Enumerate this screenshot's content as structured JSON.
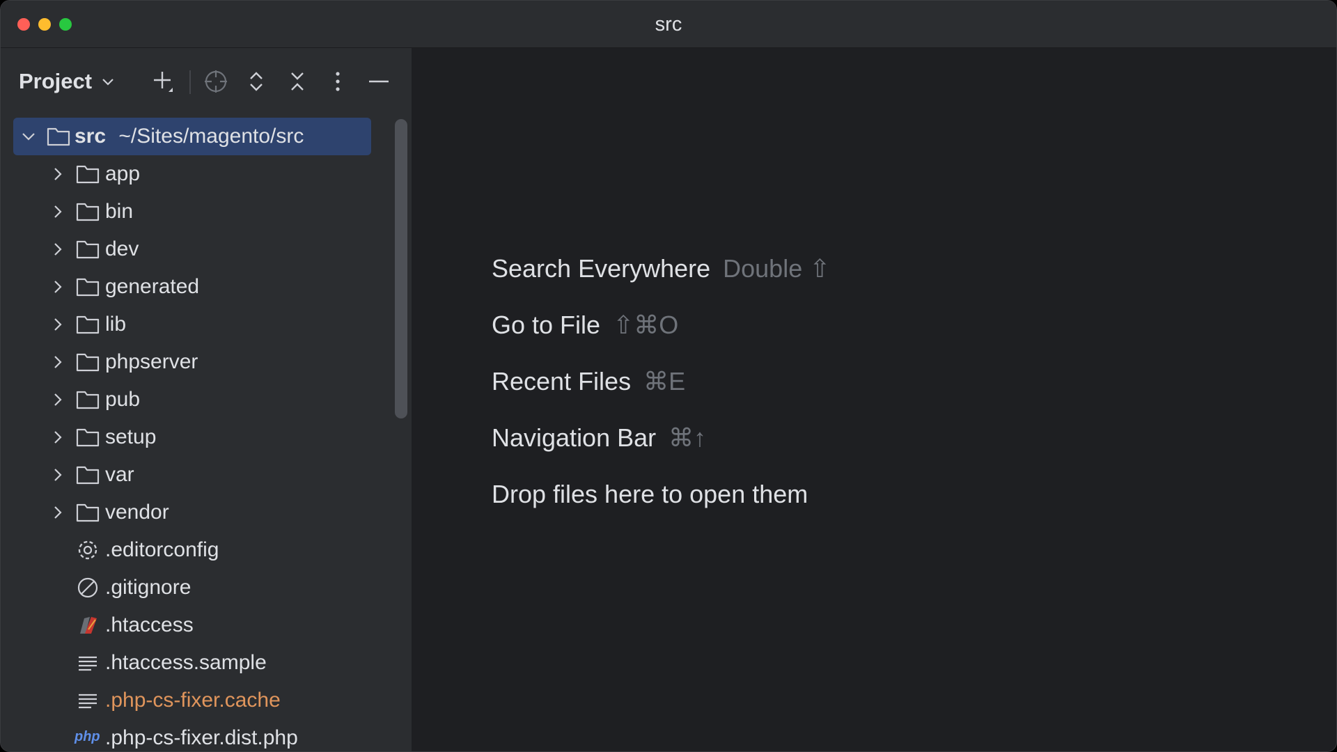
{
  "window": {
    "title": "src"
  },
  "sidebar": {
    "project_label": "Project",
    "toolbar": {
      "new": "plus-icon",
      "locate": "crosshair-icon",
      "expand": "expand-all-icon",
      "collapse": "collapse-all-icon",
      "options": "more-vertical-icon",
      "hide": "minimize-icon"
    },
    "root": {
      "name": "src",
      "path": "~/Sites/magento/src"
    },
    "items": [
      {
        "label": "app",
        "type": "folder"
      },
      {
        "label": "bin",
        "type": "folder"
      },
      {
        "label": "dev",
        "type": "folder"
      },
      {
        "label": "generated",
        "type": "folder"
      },
      {
        "label": "lib",
        "type": "folder"
      },
      {
        "label": "phpserver",
        "type": "folder"
      },
      {
        "label": "pub",
        "type": "folder"
      },
      {
        "label": "setup",
        "type": "folder"
      },
      {
        "label": "var",
        "type": "folder"
      },
      {
        "label": "vendor",
        "type": "folder"
      },
      {
        "label": ".editorconfig",
        "type": "settings-file"
      },
      {
        "label": ".gitignore",
        "type": "ignore-file"
      },
      {
        "label": ".htaccess",
        "type": "apache-file"
      },
      {
        "label": ".htaccess.sample",
        "type": "text-file"
      },
      {
        "label": ".php-cs-fixer.cache",
        "type": "text-file-ignored"
      },
      {
        "label": ".php-cs-fixer.dist.php",
        "type": "php-file"
      }
    ],
    "php_badge": "php"
  },
  "editor": {
    "hints": [
      {
        "label": "Search Everywhere",
        "shortcut": "Double ⇧"
      },
      {
        "label": "Go to File",
        "shortcut": "⇧⌘O"
      },
      {
        "label": "Recent Files",
        "shortcut": "⌘E"
      },
      {
        "label": "Navigation Bar",
        "shortcut": "⌘↑"
      },
      {
        "label": "Drop files here to open them",
        "shortcut": ""
      }
    ]
  },
  "colors": {
    "accent_selection": "#2E436E",
    "ignored_file": "#E0955C",
    "muted": "#6F737A"
  }
}
